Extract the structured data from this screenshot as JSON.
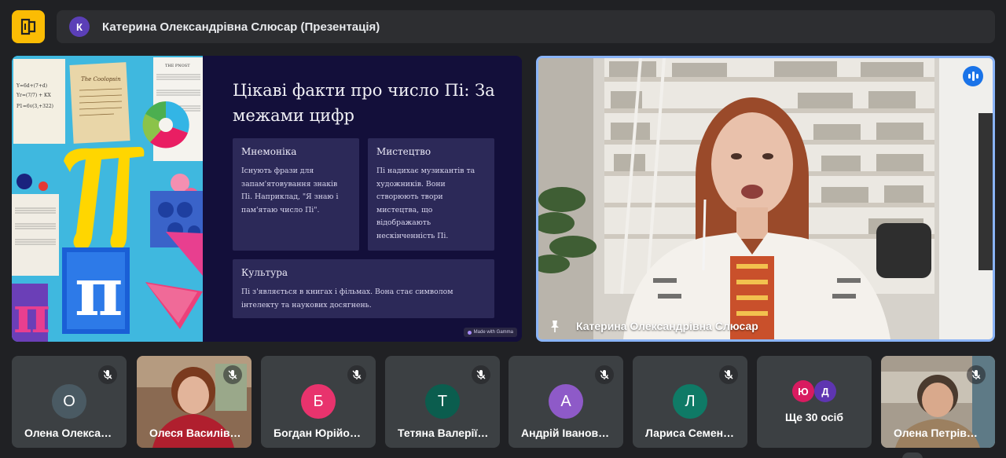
{
  "header": {
    "avatar_initial": "К",
    "title": "Катерина Олександрівна Слюсар (Презентація)",
    "accent_color": "#fbbc04"
  },
  "slide": {
    "title": "Цікаві факти про число Пі: За межами цифр",
    "art": {
      "paper_title": "The Coolopsin",
      "sheet_title": "THE PNOST",
      "note_lines": [
        "Y=6d+(7+d)",
        "Yr=(7/7) + KX",
        "P1=6v(3,+322)"
      ],
      "symbol": "π"
    },
    "cards": [
      {
        "title": "Мнемоніка",
        "text": "Існують фрази для запам'ятовування знаків Пі. Наприклад, \"Я знаю і пам'ятаю число Пі\"."
      },
      {
        "title": "Мистецтво",
        "text": "Пі надихає музикантів та художників. Вони створюють твори мистецтва, що відображають нескінченність Пі."
      },
      {
        "title": "Культура",
        "text": "Пі з'являється в книгах і фільмах. Вона стає символом інтелекту та наукових досягнень."
      }
    ],
    "badge": "Made with Gamma"
  },
  "speaker": {
    "name": "Катерина Олександрівна Слюсар",
    "border_color": "#8ab4f8"
  },
  "participants": [
    {
      "initial": "О",
      "name": "Олена Олекса…",
      "color": "#4a5a63",
      "video": false
    },
    {
      "initial": "",
      "name": "Олеся Василів…",
      "color": "#8d6e63",
      "video": true
    },
    {
      "initial": "Б",
      "name": "Богдан Юрійо…",
      "color": "#e8336d",
      "video": false
    },
    {
      "initial": "Т",
      "name": "Тетяна Валерії…",
      "color": "#0b5d4e",
      "video": false
    },
    {
      "initial": "А",
      "name": "Андрій Іванов…",
      "color": "#8e5ac8",
      "video": false
    },
    {
      "initial": "Л",
      "name": "Лариса Семен…",
      "color": "#0f7a66",
      "video": false
    }
  ],
  "more": {
    "avatars": [
      {
        "initial": "Ю",
        "color": "#d81b60"
      },
      {
        "initial": "Д",
        "color": "#5e35b1"
      }
    ],
    "label": "Ще 30 осіб"
  },
  "last_participant": {
    "name": "Олена Петрів…",
    "video": true
  }
}
